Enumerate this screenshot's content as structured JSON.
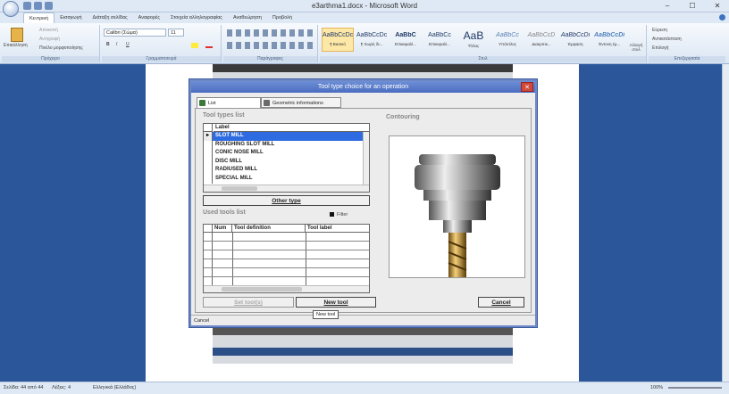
{
  "window": {
    "title": "e3arthma1.docx - Microsoft Word",
    "min": "–",
    "max": "☐",
    "close": "✕"
  },
  "tabs": [
    "Κεντρική",
    "Εισαγωγή",
    "Διάταξη σελίδας",
    "Αναφορές",
    "Στοιχεία αλληλογραφίας",
    "Αναθεώρηση",
    "Προβολή"
  ],
  "ribbon": {
    "clipboard": {
      "paste": "Επικόλληση",
      "cut": "Αποκοπή",
      "copy": "Αντιγραφή",
      "painter": "Πινέλο μορφοποίησης",
      "label": "Πρόχειρο"
    },
    "font": {
      "name": "Calibri (Σώμα)",
      "size": "11",
      "label": "Γραμματοσειρά",
      "bold": "B",
      "italic": "I",
      "underline": "U"
    },
    "paragraph": {
      "label": "Παράγραφος"
    },
    "styles": {
      "items": [
        {
          "sample": "AaBbCcDc",
          "name": "¶ Βασικό"
        },
        {
          "sample": "AaBbCcDc",
          "name": "¶ Χωρίς δι..."
        },
        {
          "sample": "AaBbC",
          "name": "Επικεφαλί..."
        },
        {
          "sample": "AaBbCc",
          "name": "Επικεφαλί..."
        },
        {
          "sample": "AaB",
          "name": "Τίτλος"
        },
        {
          "sample": "AaBbCc",
          "name": "Υπότιτλος"
        },
        {
          "sample": "AaBbCcD",
          "name": "Διακριτικ..."
        },
        {
          "sample": "AaBbCcDi",
          "name": "Έμφαση"
        },
        {
          "sample": "AaBbCcDi",
          "name": "Έντονη έμ..."
        }
      ],
      "change": "Αλλαγή στυλ",
      "label": "Στυλ"
    },
    "editing": {
      "find": "Εύρεση",
      "replace": "Αντικατάσταση",
      "select": "Επιλογή",
      "label": "Επεξεργασία"
    }
  },
  "status": {
    "page": "Σελίδα: 44 από 44",
    "words": "Λέξεις: 4",
    "lang": "Ελληνικά (Ελλάδος)",
    "zoom": "100%"
  },
  "dialog": {
    "title": "Tool type choice for an operation",
    "close": "✕",
    "tabs": [
      "List",
      "Geometric informations"
    ],
    "tool_types_title": "Tool types list",
    "label_header": "Label",
    "tool_types": [
      "SLOT MILL",
      "ROUGHING SLOT MILL",
      "CONIC NOSE MILL",
      "DISC MILL",
      "RADIUSED MILL",
      "SPECIAL MILL"
    ],
    "selected_index": 0,
    "other_type": "Other type",
    "used_tools_title": "Used tools list",
    "filter": "Filter",
    "used_headers": [
      "Num",
      "Tool definition",
      "Tool label"
    ],
    "set_tools": "Set tool(s)",
    "new_tool": "New tool",
    "preview_title": "Contouring",
    "cancel": "Cancel",
    "status": "Cancel",
    "tooltip": "New tool"
  }
}
